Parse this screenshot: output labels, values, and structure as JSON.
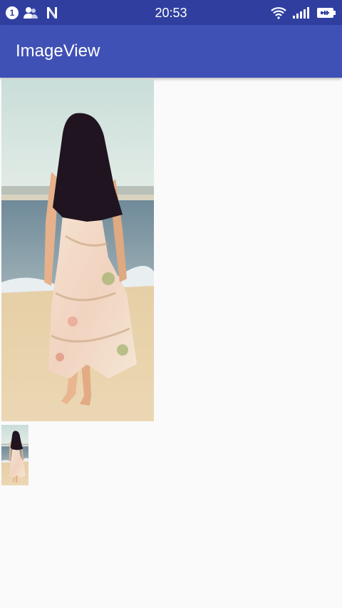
{
  "status_bar": {
    "notification_count": "1",
    "time": "20:53",
    "icons": [
      "notification-badge-icon",
      "account-icon",
      "n-logo-icon",
      "wifi-icon",
      "signal-icon",
      "battery-charging-icon"
    ]
  },
  "app_bar": {
    "title": "ImageView",
    "color": "#3f51b5",
    "status_color": "#303f9f"
  },
  "images": [
    {
      "name": "photo-large",
      "subject": "woman walking on beach"
    },
    {
      "name": "photo-thumbnail",
      "subject": "woman walking on beach"
    }
  ]
}
